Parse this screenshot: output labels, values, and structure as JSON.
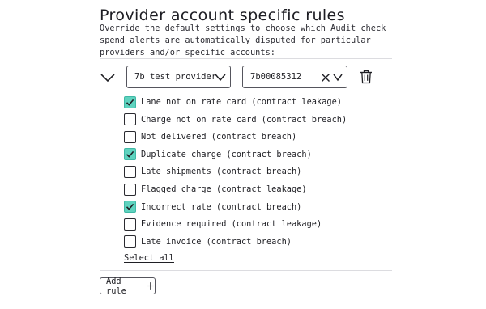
{
  "section": {
    "title": "Provider account specific rules",
    "description": "Override the default settings to choose which Audit check spend alerts are automatically disputed for particular providers and/or specific accounts:"
  },
  "rule": {
    "provider": {
      "selected": "7b test provider"
    },
    "account": {
      "selected": "7b00085312"
    },
    "options": [
      {
        "label": "Lane not on rate card (contract leakage)",
        "checked": true
      },
      {
        "label": "Charge not on rate card (contract breach)",
        "checked": false
      },
      {
        "label": "Not delivered (contract breach)",
        "checked": false
      },
      {
        "label": "Duplicate charge (contract breach)",
        "checked": true
      },
      {
        "label": "Late shipments (contract breach)",
        "checked": false
      },
      {
        "label": "Flagged charge (contract leakage)",
        "checked": false
      },
      {
        "label": "Incorrect rate (contract breach)",
        "checked": true
      },
      {
        "label": "Evidence required (contract leakage)",
        "checked": false
      },
      {
        "label": "Late invoice (contract breach)",
        "checked": false
      }
    ],
    "select_all_label": "Select all"
  },
  "actions": {
    "add_rule_label": "Add rule"
  },
  "icons": {
    "collapse": "chevron-down-icon",
    "dropdown": "chevron-down-icon",
    "clear": "close-icon",
    "delete": "trash-icon",
    "checkmark": "check-icon",
    "add": "plus-icon"
  },
  "colors": {
    "checkbox_checked": "#5fd3bf",
    "text": "#1f1f24",
    "border": "#55555d"
  }
}
